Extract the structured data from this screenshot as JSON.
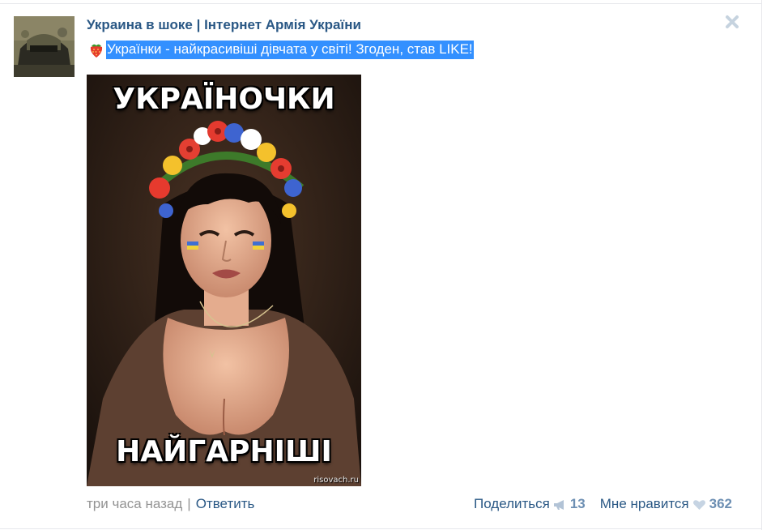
{
  "post": {
    "author": "Украина в шоке | Інтернет Армія України",
    "text": "Українки - найкрасивіші дівчата у світі! Згоден, став LIKE!",
    "image": {
      "top_caption": "УКРАЇНОЧКИ",
      "bottom_caption": "НАЙГАРНІШІ",
      "watermark": "risovach.ru"
    },
    "time": "три часа назад",
    "separator": "|",
    "reply_label": "Ответить",
    "share_label": "Поделиться",
    "share_count": "13",
    "like_label": "Мне нравится",
    "like_count": "362"
  },
  "icons": {
    "close": "close-icon",
    "emoji": "strawberry-icon",
    "share": "megaphone-icon",
    "like": "heart-icon"
  },
  "colors": {
    "link": "#2a5885",
    "muted": "#939393",
    "count": "#6d8fb3",
    "selection": "#3390ff"
  }
}
